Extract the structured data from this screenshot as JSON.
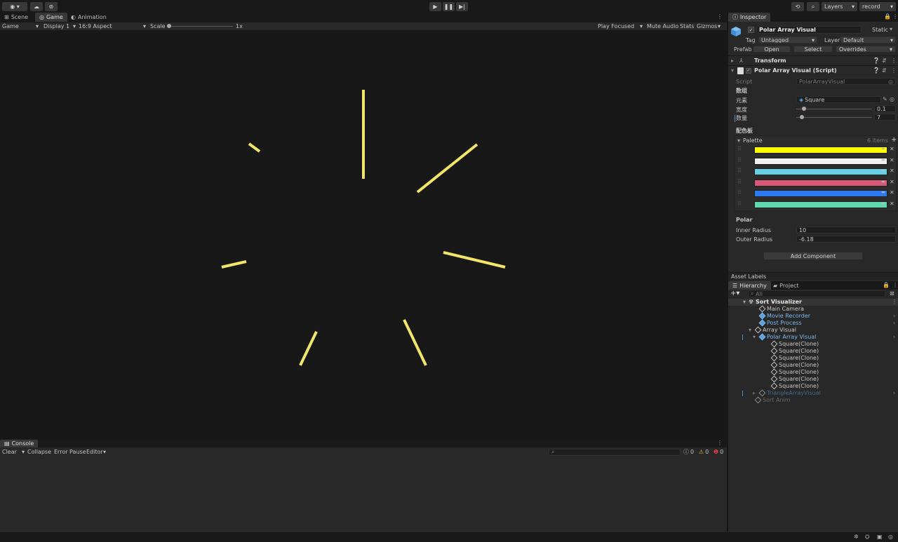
{
  "toolbar": {
    "account_icon": "account-icon",
    "cloud_icon": "cloud-icon",
    "collab_icon": "collab-icon",
    "layers_label": "Layers",
    "layout_label": "record",
    "history_icon": "history-icon",
    "search_icon": "search-icon"
  },
  "tabs": {
    "scene": "Scene",
    "game": "Game",
    "animation": "Animation",
    "inspector": "Inspector",
    "console": "Console",
    "hierarchy": "Hierarchy",
    "project": "Project"
  },
  "gamebar": {
    "mode": "Game",
    "display": "Display 1",
    "aspect": "16:9 Aspect",
    "scale_label": "Scale",
    "scale_value": "1x",
    "play_focused": "Play Focused",
    "mute_audio": "Mute Audio",
    "stats": "Stats",
    "gizmos": "Gizmos"
  },
  "inspector": {
    "object_name": "Polar Array Visual",
    "static_label": "Static",
    "tag_label": "Tag",
    "tag_value": "Untagged",
    "layer_label": "Layer",
    "layer_value": "Default",
    "prefab_label": "Prefab",
    "open_label": "Open",
    "select_label": "Select",
    "overrides_label": "Overrides",
    "transform_label": "Transform",
    "script_component": "Polar Array Visual (Script)",
    "script_label": "Script",
    "script_value": "PolarArrayVisual",
    "section_array": "数组",
    "element_label": "元素",
    "element_value": "Square",
    "width_label": "宽度",
    "width_value": "0.1",
    "count_label": "数量",
    "count_value": "7",
    "width_slider": 0.1,
    "count_slider": 0.07,
    "section_palette": "配色板",
    "palette_label": "Palette",
    "palette_count": "6 items",
    "palette_colors": [
      "#ffff00",
      "#f0f0f0",
      "#66cfe8",
      "#d65a78",
      "#2e7af0",
      "#5fd8b0"
    ],
    "section_polar": "Polar",
    "inner_radius_label": "Inner Radius",
    "inner_radius_value": "10",
    "outer_radius_label": "Outer Radius",
    "outer_radius_value": "-6.18",
    "add_component": "Add Component",
    "asset_labels": "Asset Labels"
  },
  "hierarchy": {
    "search_placeholder": "All",
    "scene_name": "Sort Visualizer",
    "items": [
      {
        "label": "Main Camera",
        "style": "normal"
      },
      {
        "label": "Movie Recorder",
        "style": "prefab"
      },
      {
        "label": "Post Process",
        "style": "prefab"
      },
      {
        "label": "Array Visual",
        "style": "normal"
      },
      {
        "label": "Polar Array Visual",
        "style": "prefab-selected"
      },
      {
        "label": "Square(Clone)",
        "style": "normal"
      },
      {
        "label": "Square(Clone)",
        "style": "normal"
      },
      {
        "label": "Square(Clone)",
        "style": "normal"
      },
      {
        "label": "Square(Clone)",
        "style": "normal"
      },
      {
        "label": "Square(Clone)",
        "style": "normal"
      },
      {
        "label": "Square(Clone)",
        "style": "normal"
      },
      {
        "label": "Square(Clone)",
        "style": "normal"
      },
      {
        "label": "TriangleArrayVisual",
        "style": "disabled-prefab"
      },
      {
        "label": "Sort Anim",
        "style": "disabled"
      }
    ]
  },
  "console": {
    "clear": "Clear",
    "collapse": "Collapse",
    "error_pause": "Error Pause",
    "editor": "Editor",
    "log_count": "0",
    "warn_count": "0",
    "error_count": "0"
  },
  "scene_bar_color": "#f2e66a"
}
